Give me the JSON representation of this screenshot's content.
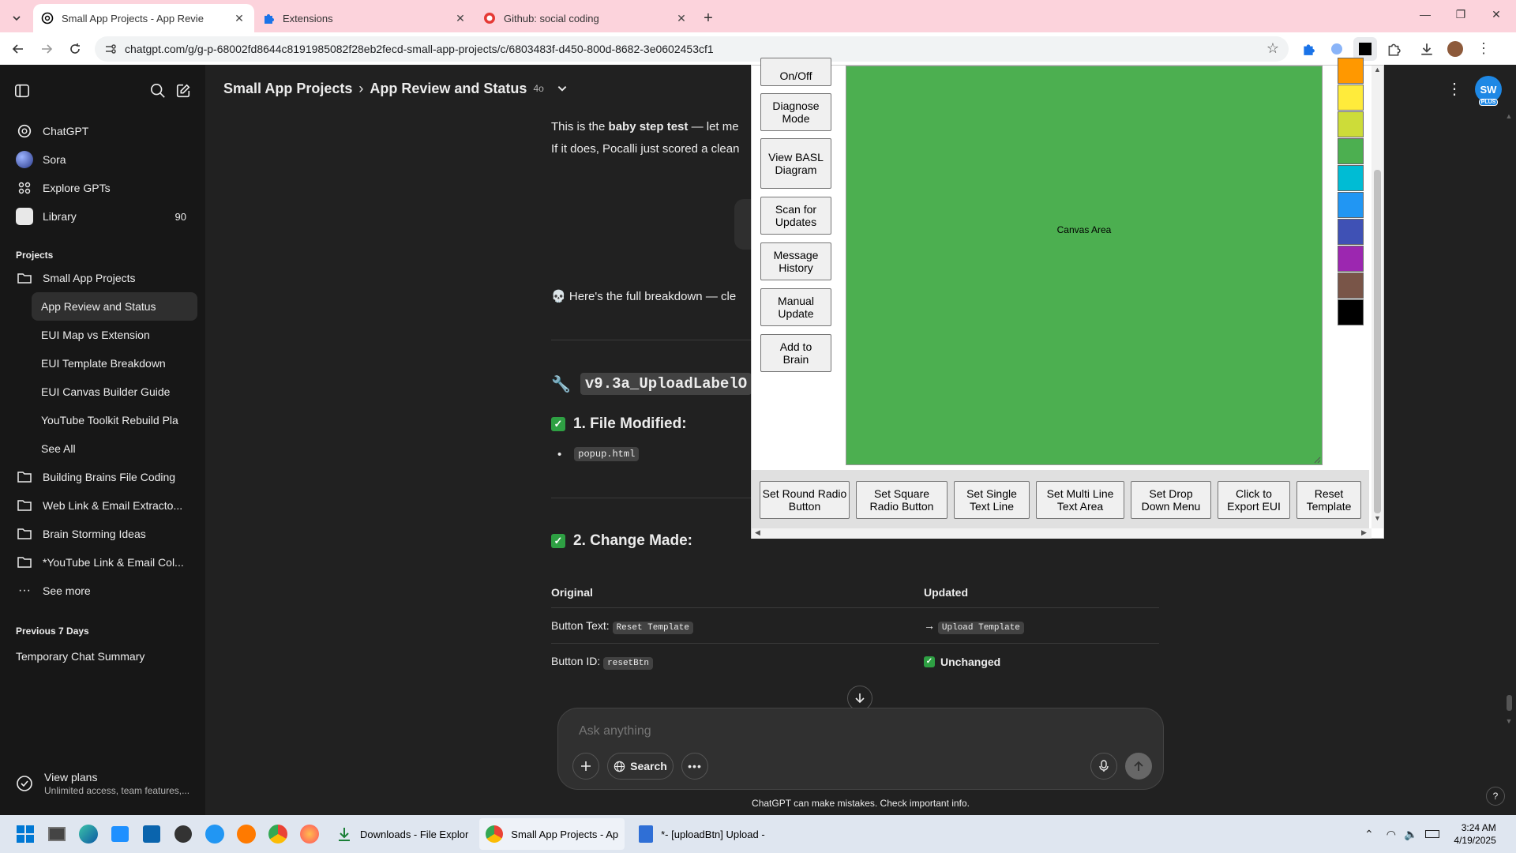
{
  "browser": {
    "tabs": [
      {
        "title": "Small App Projects - App Revie",
        "active": true
      },
      {
        "title": "Extensions",
        "active": false
      },
      {
        "title": "Github: social coding",
        "active": false
      }
    ],
    "url": "chatgpt.com/g/g-p-68002fd8644c8191985082f28eb2fecd-small-app-projects/c/6803483f-d450-800d-8682-3e0602453cf1"
  },
  "sidebar": {
    "top_items": [
      {
        "label": "ChatGPT",
        "icon": "chatgpt-icon"
      },
      {
        "label": "Sora",
        "icon": "sora-icon"
      },
      {
        "label": "Explore GPTs",
        "icon": "grid-icon"
      },
      {
        "label": "Library",
        "icon": "library-icon",
        "count": "90"
      }
    ],
    "projects_heading": "Projects",
    "project_name": "Small App Projects",
    "project_chats": [
      "App Review and Status",
      "EUI Map vs Extension",
      "EUI Template Breakdown",
      "EUI Canvas Builder Guide",
      "YouTube Toolkit Rebuild Pla",
      "See All"
    ],
    "other_projects": [
      "Building Brains File Coding",
      "Web Link & Email Extracto...",
      "Brain Storming Ideas",
      "*YouTube Link & Email Col..."
    ],
    "see_more": "See more",
    "previous_heading": "Previous 7 Days",
    "previous_items": [
      "Temporary Chat Summary"
    ],
    "plans_title": "View plans",
    "plans_sub": "Unlimited access, team features,..."
  },
  "header": {
    "project": "Small App Projects",
    "chat": "App Review and Status",
    "model": "4o",
    "avatar": "SW",
    "avatar_badge": "PLUS"
  },
  "chat": {
    "intro_pre": "This is the ",
    "intro_bold": "baby step test",
    "intro_post": " — let me",
    "intro_line2": "If it does, Pocalli just scored a clean",
    "breakdown_emoji": "💀",
    "breakdown": "Here's the full breakdown — cle",
    "version_emoji": "🔧",
    "version_code": "v9.3a_UploadLabelO",
    "section1": "1. File Modified:",
    "file_item": "popup.html",
    "section2": "2. Change Made:",
    "table_headers": [
      "Original",
      "Updated"
    ],
    "rows": [
      {
        "label": "Button Text:",
        "original_code": "Reset Template",
        "arrow": "→",
        "updated_code": "Upload Template"
      },
      {
        "label": "Button ID:",
        "original_code": "resetBtn",
        "updated_text": "Unchanged"
      }
    ]
  },
  "popup": {
    "side_buttons": [
      "On/Off",
      "Diagnose Mode",
      "View BASL Diagram",
      "Scan for Updates",
      "Message History",
      "Manual Update",
      "Add to Brain"
    ],
    "canvas_label": "Canvas Area",
    "canvas_color": "#4caf50",
    "swatches": [
      "#ff9800",
      "#ffeb3b",
      "#cddc39",
      "#4caf50",
      "#00bcd4",
      "#2196f3",
      "#3f51b5",
      "#9c27b0",
      "#795548",
      "#000000"
    ],
    "bottom_buttons": [
      "Set Round Radio Button",
      "Set Square Radio Button",
      "Set Single Text Line",
      "Set Multi Line Text Area",
      "Set Drop Down Menu",
      "Click to Export EUI",
      "Reset Template"
    ]
  },
  "composer": {
    "placeholder": "Ask anything",
    "search_label": "Search",
    "disclaimer": "ChatGPT can make mistakes. Check important info.",
    "help": "?"
  },
  "taskbar": {
    "apps": [
      {
        "label": "Downloads - File Explor"
      },
      {
        "label": "Small App Projects - Ap"
      },
      {
        "label": "*- [uploadBtn] Upload -"
      }
    ],
    "time": "3:24 AM",
    "date": "4/19/2025"
  }
}
